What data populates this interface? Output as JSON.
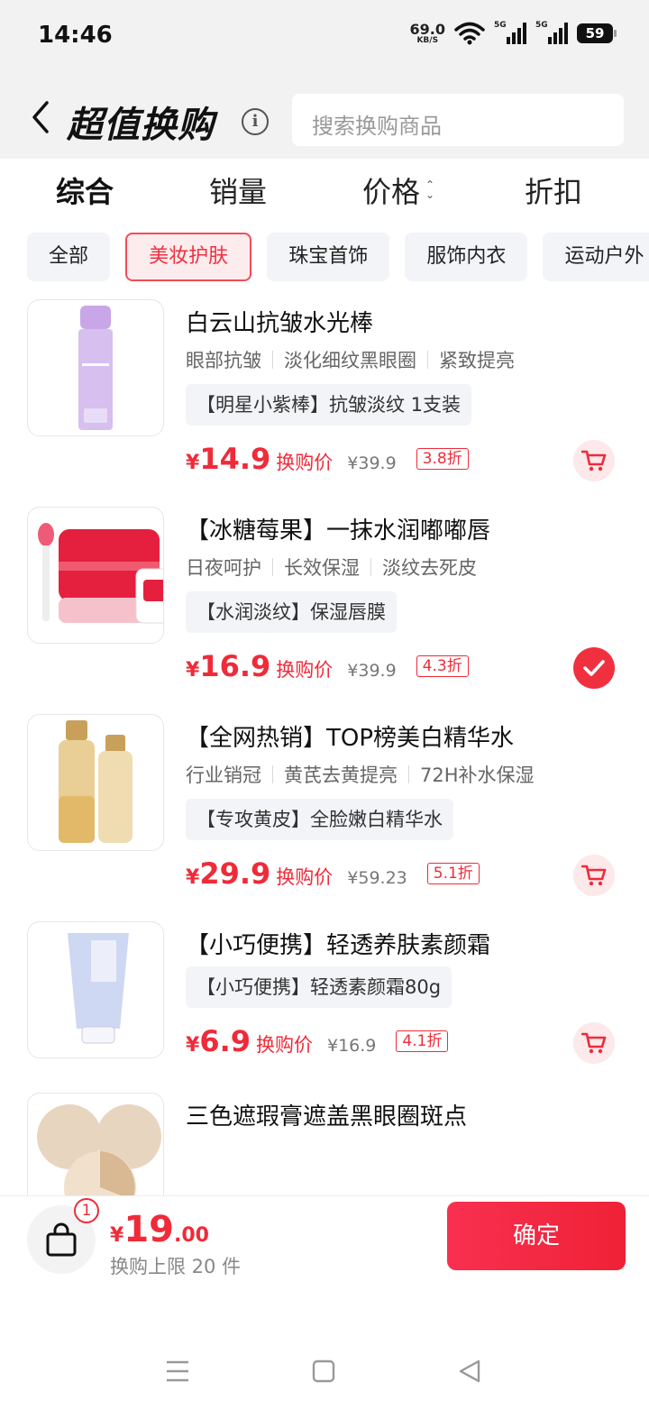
{
  "status_bar": {
    "time": "14:46",
    "net_speed": "69.0",
    "net_unit": "KB/S",
    "signal1": "5G",
    "signal2": "5G",
    "battery": "59"
  },
  "header": {
    "title": "超值换购",
    "search_placeholder": "搜索换购商品"
  },
  "sort_tabs": [
    "综合",
    "销量",
    "价格",
    "折扣"
  ],
  "categories": [
    "全部",
    "美妆护肤",
    "珠宝首饰",
    "服饰内衣",
    "运动户外"
  ],
  "active_category": "美妆护肤",
  "products": [
    {
      "name": "白云山抗皱水光棒",
      "tags": [
        "眼部抗皱",
        "淡化细纹黑眼圈",
        "紧致提亮"
      ],
      "promo": "【明星小紫棒】抗皱淡纹 1支装",
      "price": "14.9",
      "price_label": "换购价",
      "orig_price": "¥39.9",
      "discount": "3.8折",
      "selected": false
    },
    {
      "name": "【冰糖莓果】一抹水润嘟嘟唇",
      "tags": [
        "日夜呵护",
        "长效保湿",
        "淡纹去死皮"
      ],
      "promo": "【水润淡纹】保湿唇膜",
      "price": "16.9",
      "price_label": "换购价",
      "orig_price": "¥39.9",
      "discount": "4.3折",
      "selected": true
    },
    {
      "name": "【全网热销】TOP榜美白精华水",
      "tags": [
        "行业销冠",
        "黄芪去黄提亮",
        "72H补水保湿"
      ],
      "promo": "【专攻黄皮】全脸嫩白精华水",
      "price": "29.9",
      "price_label": "换购价",
      "orig_price": "¥59.23",
      "discount": "5.1折",
      "selected": false
    },
    {
      "name": "【小巧便携】轻透养肤素颜霜",
      "tags": [],
      "promo": "【小巧便携】轻透素颜霜80g",
      "price": "6.9",
      "price_label": "换购价",
      "orig_price": "¥16.9",
      "discount": "4.1折",
      "selected": false
    },
    {
      "name": "三色遮瑕膏遮盖黑眼圈斑点",
      "tags": [],
      "promo": "",
      "price": "",
      "price_label": "",
      "orig_price": "",
      "discount": "",
      "selected": false
    }
  ],
  "bottom": {
    "badge": "1",
    "currency": "¥",
    "total_int": "19",
    "total_dec": ".00",
    "limit": "换购上限 20 件",
    "confirm": "确定"
  },
  "colors": {
    "accent": "#ef2b39",
    "chip_bg": "#f3f4f7",
    "header_bg": "#f2f2f2"
  },
  "icons": {
    "back": "chevron-left-icon",
    "info": "info-icon",
    "cart": "cart-icon",
    "check": "check-icon",
    "top": "arrow-up-icon",
    "bag": "shopping-bag-icon"
  }
}
